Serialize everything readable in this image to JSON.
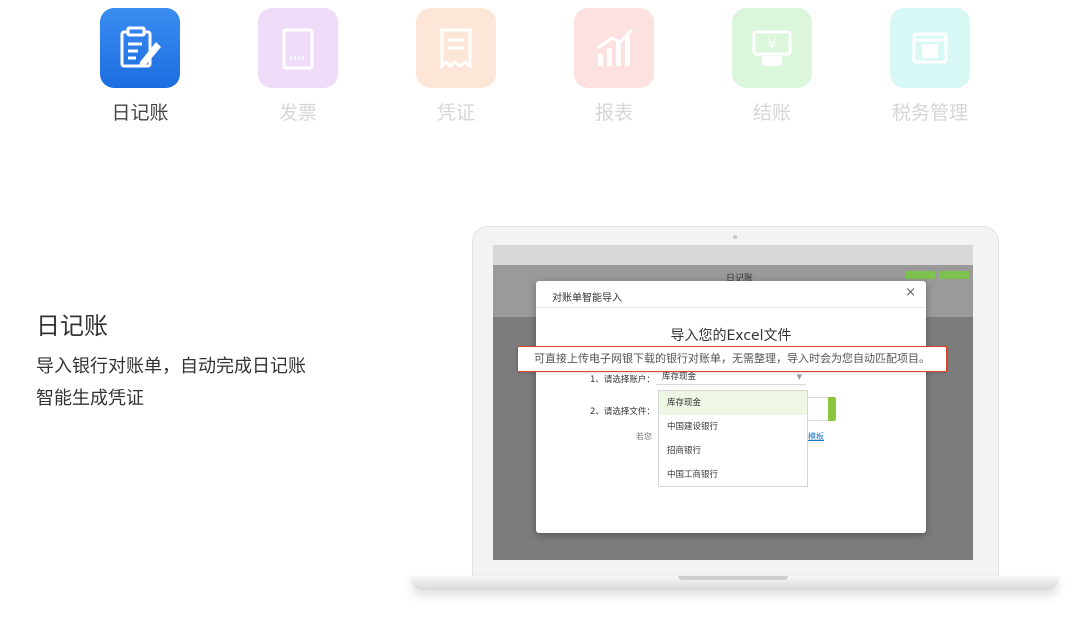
{
  "nav": {
    "items": [
      {
        "label": "日记账",
        "icon": "journal-edit-icon",
        "active": true,
        "color": "#2176e6"
      },
      {
        "label": "发票",
        "icon": "invoice-icon",
        "active": false,
        "color": "#eedcf9"
      },
      {
        "label": "凭证",
        "icon": "voucher-icon",
        "active": false,
        "color": "#fde6d7"
      },
      {
        "label": "报表",
        "icon": "report-chart-icon",
        "active": false,
        "color": "#fde0e0"
      },
      {
        "label": "结账",
        "icon": "settle-cash-icon",
        "active": false,
        "color": "#dcf6dc"
      },
      {
        "label": "税务管理",
        "icon": "tax-icon",
        "active": false,
        "color": "#d8f8f6"
      }
    ]
  },
  "feature": {
    "title": "日记账",
    "lines": [
      "导入银行对账单，自动完成日记账",
      "智能生成凭证"
    ]
  },
  "app": {
    "title": "日记账"
  },
  "dialog": {
    "title": "对账单智能导入",
    "close": "×",
    "heading": "导入您的Excel文件",
    "account_label": "1、请选择账户：",
    "account_value": "库存现金",
    "file_label": "2、请选择文件：",
    "hint_prefix": "若您",
    "hint_link": "模板",
    "dropdown": [
      "库存现金",
      "中国建设银行",
      "招商银行",
      "中国工商银行"
    ]
  },
  "tooltip": {
    "text": "可直接上传电子网银下载的银行对账单，无需整理，导入时会为您自动匹配项目。"
  },
  "colors": {
    "accent": "#2176e6",
    "green": "#8cc63f",
    "alert_border": "#d9442b"
  }
}
